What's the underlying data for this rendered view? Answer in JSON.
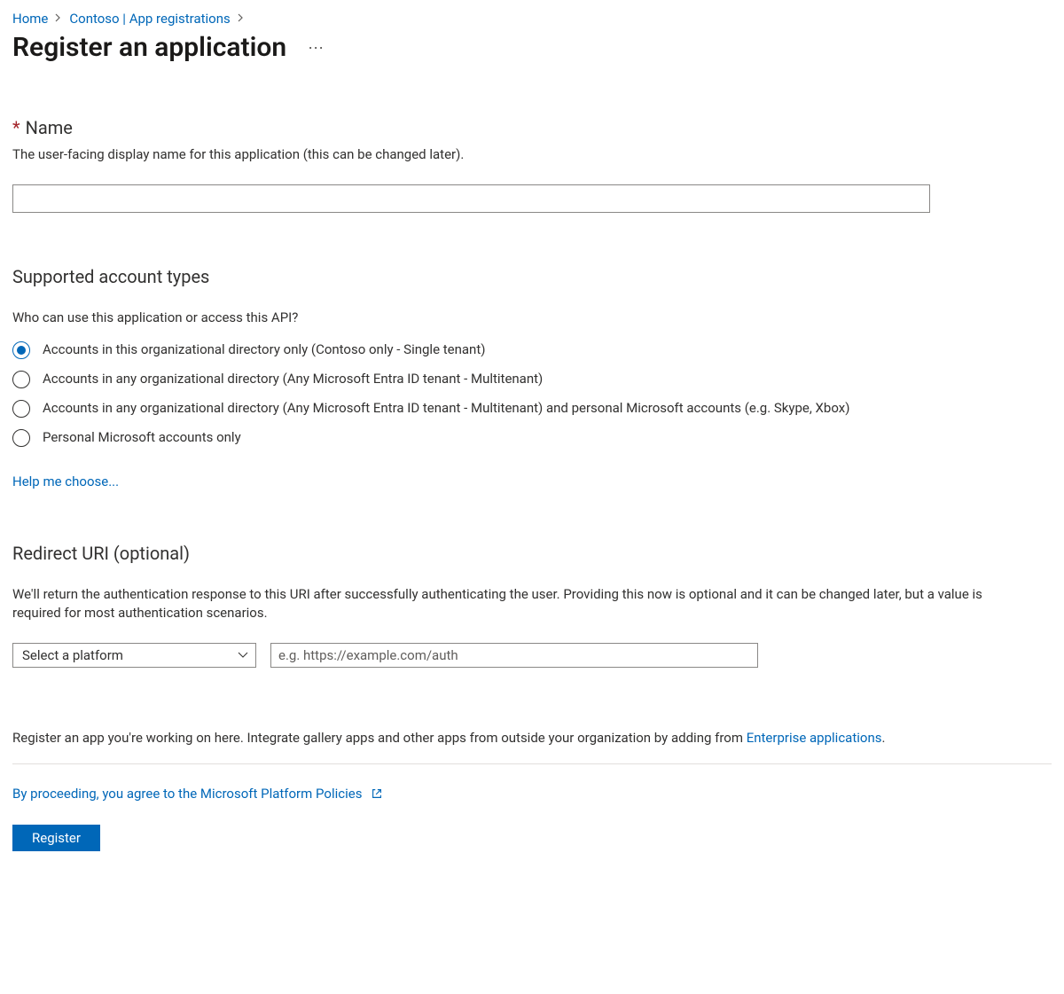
{
  "breadcrumb": {
    "home": "Home",
    "parent": "Contoso | App registrations"
  },
  "title": "Register an application",
  "name_section": {
    "label": "Name",
    "help": "The user-facing display name for this application (this can be changed later).",
    "value": ""
  },
  "account_types": {
    "heading": "Supported account types",
    "prompt": "Who can use this application or access this API?",
    "options": [
      "Accounts in this organizational directory only (Contoso only - Single tenant)",
      "Accounts in any organizational directory (Any Microsoft Entra ID tenant - Multitenant)",
      "Accounts in any organizational directory (Any Microsoft Entra ID tenant - Multitenant) and personal Microsoft accounts (e.g. Skype, Xbox)",
      "Personal Microsoft accounts only"
    ],
    "selected_index": 0,
    "help_link": "Help me choose..."
  },
  "redirect": {
    "heading": "Redirect URI (optional)",
    "help": "We'll return the authentication response to this URI after successfully authenticating the user. Providing this now is optional and it can be changed later, but a value is required for most authentication scenarios.",
    "platform_placeholder": "Select a platform",
    "uri_placeholder": "e.g. https://example.com/auth",
    "uri_value": ""
  },
  "footer": {
    "note_prefix": "Register an app you're working on here. Integrate gallery apps and other apps from outside your organization by adding from ",
    "note_link": "Enterprise applications",
    "note_suffix": ".",
    "policy": "By proceeding, you agree to the Microsoft Platform Policies",
    "register_label": "Register"
  }
}
